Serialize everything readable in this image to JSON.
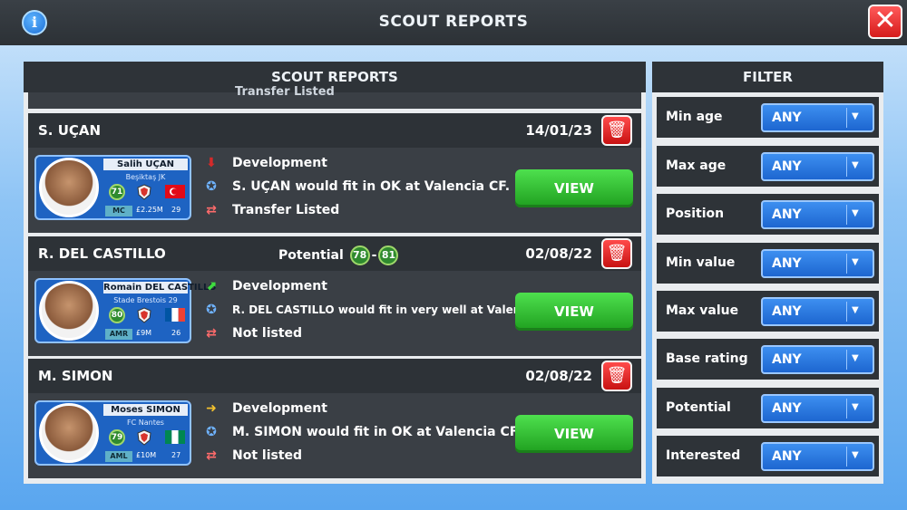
{
  "header": {
    "title": "SCOUT REPORTS"
  },
  "reports_panel": {
    "title": "SCOUT REPORTS"
  },
  "filter_panel": {
    "title": "FILTER"
  },
  "partial_card": {
    "text": "Transfer Listed"
  },
  "reports": [
    {
      "short_name": "S. UÇAN",
      "date": "14/01/23",
      "potential_label": "",
      "player": {
        "full_name": "Salih UÇAN",
        "club": "Beşiktaş JK",
        "rating": "71",
        "position": "MC",
        "value": "£2.25M",
        "age": "29",
        "flag_colors": [
          "#e30a17",
          "#ffffff"
        ]
      },
      "lines": [
        "Development",
        "S. UÇAN would fit in OK at Valencia CF.",
        "Transfer Listed"
      ],
      "development_trend": "down",
      "view_label": "VIEW"
    },
    {
      "short_name": "R. DEL CASTILLO",
      "date": "02/08/22",
      "potential_label": "Potential",
      "potential_min": "78",
      "potential_max": "81",
      "player": {
        "full_name": "Romain DEL CASTILLO",
        "club": "Stade Brestois 29",
        "rating": "80",
        "position": "AMR",
        "value": "£9M",
        "age": "26",
        "flag_colors": [
          "#0055a4",
          "#ffffff",
          "#ef4135"
        ]
      },
      "lines": [
        "Development",
        "R. DEL CASTILLO would fit in very well at Valencia CF.",
        "Not listed"
      ],
      "development_trend": "up",
      "view_label": "VIEW"
    },
    {
      "short_name": "M. SIMON",
      "date": "02/08/22",
      "potential_label": "",
      "player": {
        "full_name": "Moses SIMON",
        "club": "FC Nantes",
        "rating": "79",
        "position": "AML",
        "value": "£10M",
        "age": "27",
        "flag_colors": [
          "#008751",
          "#ffffff",
          "#008751"
        ]
      },
      "lines": [
        "Development",
        "M. SIMON would fit in OK at Valencia CF.",
        "Not listed"
      ],
      "development_trend": "flat",
      "view_label": "VIEW"
    }
  ],
  "filters": [
    {
      "label": "Min age",
      "value": "ANY"
    },
    {
      "label": "Max age",
      "value": "ANY"
    },
    {
      "label": "Position",
      "value": "ANY"
    },
    {
      "label": "Min value",
      "value": "ANY"
    },
    {
      "label": "Max value",
      "value": "ANY"
    },
    {
      "label": "Base rating",
      "value": "ANY"
    },
    {
      "label": "Potential",
      "value": "ANY"
    },
    {
      "label": "Interested",
      "value": "ANY"
    }
  ],
  "colors": {
    "accent_blue": "#1d66d0",
    "view_green": "#1f9f1f",
    "delete_red": "#d61b1b",
    "trend_up": "#3fdc3f",
    "trend_down": "#d42a2a",
    "trend_flat": "#f2c12e"
  }
}
